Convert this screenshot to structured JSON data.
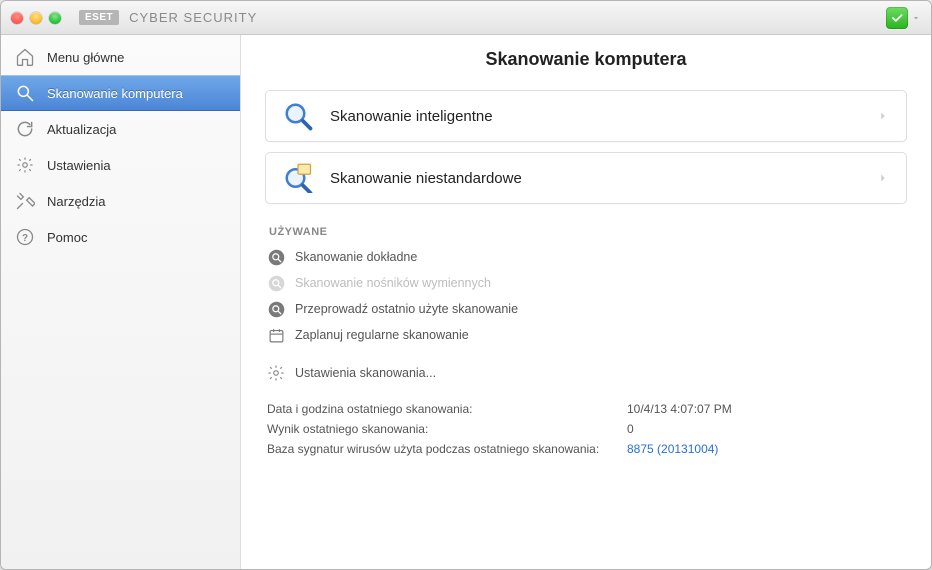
{
  "brand": {
    "logo": "ESET",
    "title": "CYBER SECURITY",
    "status_icon": "check-icon"
  },
  "sidebar": {
    "items": [
      {
        "name": "main-menu",
        "label": "Menu główne",
        "icon": "house-icon",
        "active": false
      },
      {
        "name": "scan",
        "label": "Skanowanie komputera",
        "icon": "search-icon",
        "active": true
      },
      {
        "name": "update",
        "label": "Aktualizacja",
        "icon": "refresh-icon",
        "active": false
      },
      {
        "name": "settings",
        "label": "Ustawienia",
        "icon": "gear-icon",
        "active": false
      },
      {
        "name": "tools",
        "label": "Narzędzia",
        "icon": "tools-icon",
        "active": false
      },
      {
        "name": "help",
        "label": "Pomoc",
        "icon": "help-icon",
        "active": false
      }
    ]
  },
  "page": {
    "title": "Skanowanie komputera",
    "actions": [
      {
        "name": "smart-scan",
        "label": "Skanowanie inteligentne",
        "icon": "magnifier-blue-icon"
      },
      {
        "name": "custom-scan",
        "label": "Skanowanie niestandardowe",
        "icon": "magnifier-doc-icon"
      }
    ],
    "used_header": "UŻYWANE",
    "used": [
      {
        "name": "deep-scan",
        "label": "Skanowanie dokładne",
        "icon": "round-search",
        "disabled": false
      },
      {
        "name": "removable-scan",
        "label": "Skanowanie nośników wymiennych",
        "icon": "round-search",
        "disabled": true
      },
      {
        "name": "last-scan",
        "label": "Przeprowadź ostatnio użyte skanowanie",
        "icon": "round-search",
        "disabled": false
      },
      {
        "name": "schedule-scan",
        "label": "Zaplanuj regularne skanowanie",
        "icon": "calendar-icon",
        "disabled": false
      }
    ],
    "settings_link": {
      "label": "Ustawienia skanowania...",
      "icon": "gear-small-icon"
    },
    "info": {
      "rows": [
        {
          "label": "Data i godzina ostatniego skanowania:",
          "value": "10/4/13 4:07:07 PM",
          "link": false
        },
        {
          "label": "Wynik ostatniego skanowania:",
          "value": "0",
          "link": false
        },
        {
          "label": "Baza sygnatur wirusów użyta podczas ostatniego skanowania:",
          "value": "8875 (20131004)",
          "link": true
        }
      ]
    }
  }
}
